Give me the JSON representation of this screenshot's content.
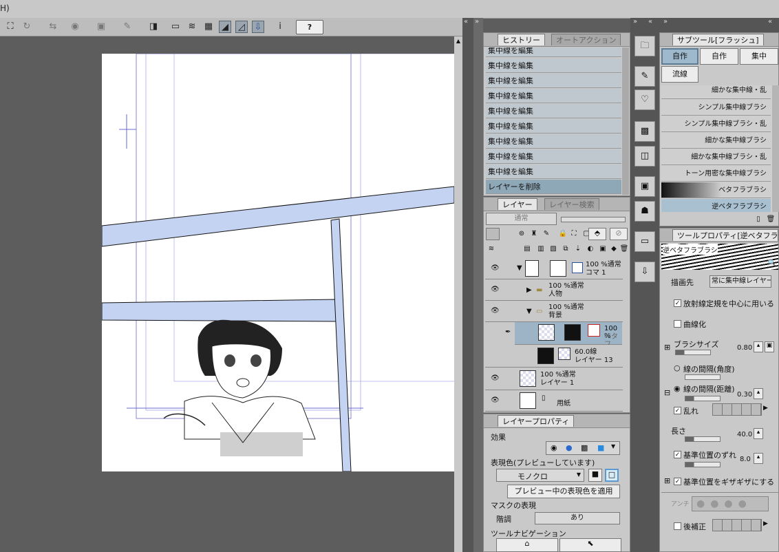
{
  "menubar": {
    "text": "H)"
  },
  "toolbar": {
    "help_label": "?",
    "info_label": "i"
  },
  "dock_arrows": {
    "left1": "«",
    "left2": "»",
    "mid1": "»",
    "mid2": "«",
    "right1": "»",
    "right2": "«"
  },
  "history": {
    "tabs": [
      "ヒストリー",
      "オートアクション"
    ],
    "items": [
      "集中線を編集",
      "集中線を編集",
      "集中線を編集",
      "集中線を編集",
      "集中線を編集",
      "集中線を編集",
      "集中線を編集",
      "集中線を編集",
      "集中線を編集",
      "レイヤーを削除"
    ]
  },
  "layers": {
    "tabs": [
      "レイヤー",
      "レイヤー検索"
    ],
    "blend_mode": "通常",
    "rows": [
      {
        "line1": "100 %通常",
        "line2": "コマ 1"
      },
      {
        "line1": "100 %通常",
        "line2": "人物"
      },
      {
        "line1": "100 %通常",
        "line2": "背景"
      },
      {
        "line1": "100 %",
        "line2": "ベタフ"
      },
      {
        "line1": "60.0線",
        "line2": "レイヤー 13"
      },
      {
        "line1": "100 %通常",
        "line2": "レイヤー 1"
      },
      {
        "line1": "",
        "line2": "用紙"
      }
    ]
  },
  "layer_property": {
    "tab": "レイヤープロパティ",
    "effect_label": "効果",
    "color_label": "表現色(プレビューしています)",
    "color_value": "モノクロ",
    "apply_button": "プレビュー中の表現色を適用",
    "mask_label": "マスクの表現",
    "tone_label": "階調",
    "tone_value": "あり",
    "nav_label": "ツールナビゲーション"
  },
  "subtool": {
    "tab": "サブツール[フラッシュ]",
    "tool_buttons": [
      "自作",
      "自作",
      "集中",
      "流線"
    ],
    "brushes": [
      "細かな集中線・乱",
      "シンプル集中線ブラシ",
      "シンプル集中線ブラシ・乱",
      "細かな集中線ブラシ",
      "細かな集中線ブラシ・乱",
      "トーン用密な集中線ブラシ",
      "ベタフラブラシ",
      "逆ベタフラブラシ"
    ]
  },
  "tool_property": {
    "tab": "ツールプロパティ[逆ベタフラ",
    "preview_label": "逆ベタフラブラシ",
    "draw_target_label": "描画先",
    "draw_target_value": "常に集中線レイヤー",
    "radial_label": "放射線定規を中心に用いる",
    "curve_label": "曲線化",
    "brush_size_label": "ブラシサイズ",
    "brush_size_value": "0.80",
    "angle_label": "線の間隔(角度)",
    "distance_label": "線の間隔(距離)",
    "distance_value": "0.30",
    "random_label": "乱れ",
    "length_label": "長さ",
    "length_value": "40.0",
    "offset_label": "基準位置のずれ",
    "offset_value": "8.0",
    "jagged_label": "基準位置をギザギザにする",
    "antialias_label": "アンチ",
    "correction_label": "後補正"
  }
}
